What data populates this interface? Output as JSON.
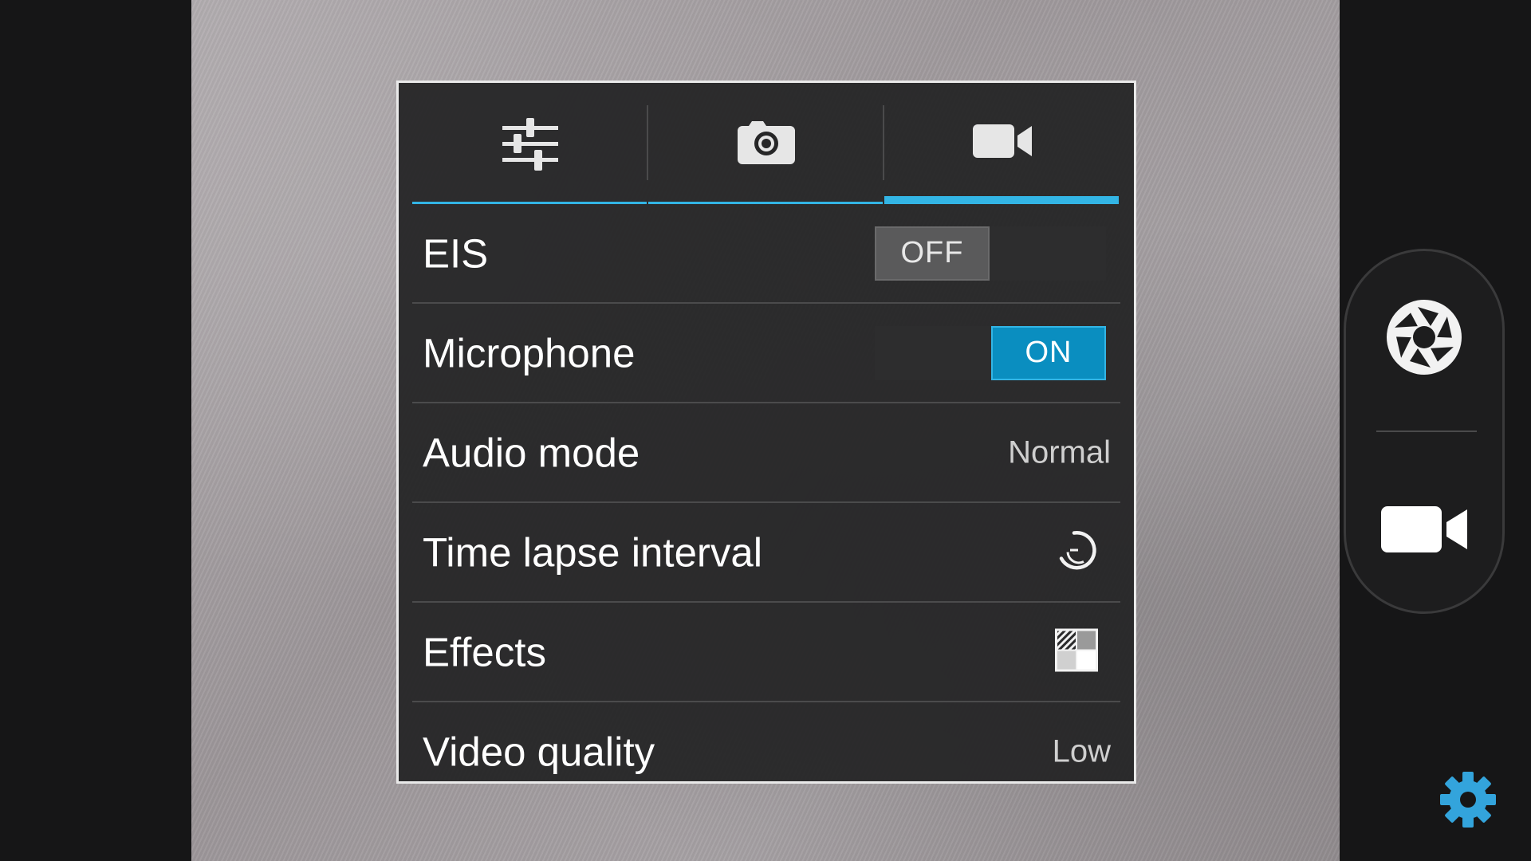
{
  "tabs": [
    {
      "id": "general",
      "icon": "sliders-icon",
      "active": false
    },
    {
      "id": "photo",
      "icon": "camera-icon",
      "active": false
    },
    {
      "id": "video",
      "icon": "video-camera-icon",
      "active": true
    }
  ],
  "settings": {
    "eis": {
      "label": "EIS",
      "value": "OFF"
    },
    "microphone": {
      "label": "Microphone",
      "value": "ON"
    },
    "audio_mode": {
      "label": "Audio mode",
      "value": "Normal"
    },
    "time_lapse": {
      "label": "Time lapse interval",
      "icon": "timer-off-icon"
    },
    "effects": {
      "label": "Effects",
      "icon": "effects-icon"
    },
    "video_quality": {
      "label": "Video quality",
      "value": "Low"
    }
  },
  "side_controls": {
    "photo_mode_icon": "shutter-icon",
    "video_mode_icon": "video-camera-icon",
    "settings_icon": "gear-icon"
  },
  "colors": {
    "accent": "#33b5e5",
    "toggle_on": "#0a8ec0",
    "panel_bg": "#242425",
    "gear": "#33a4dc"
  }
}
